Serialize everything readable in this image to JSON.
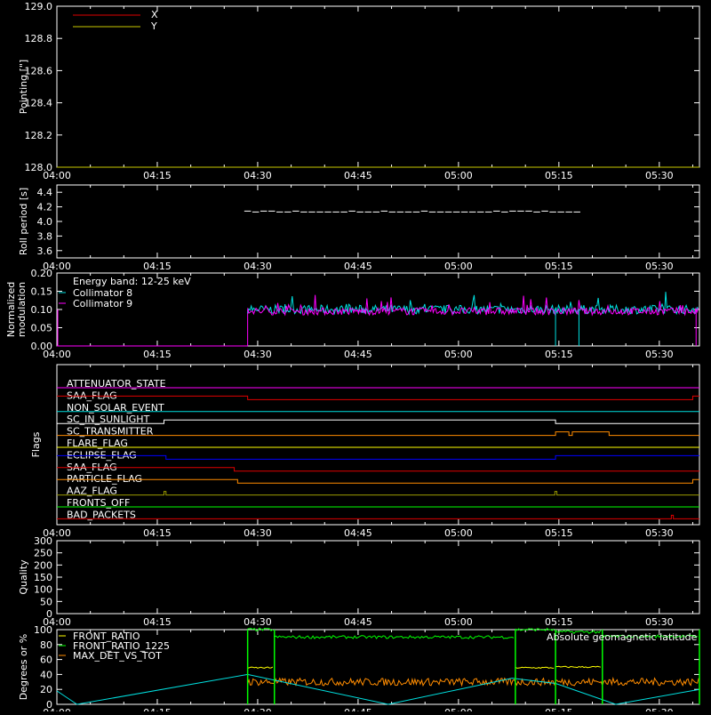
{
  "colors": {
    "bg": "#000000",
    "axis": "#ffffff",
    "red": "#e00000",
    "yellow": "#c8c800",
    "cyan": "#00e0e0",
    "magenta": "#ff00ff",
    "orange": "#ff8c00",
    "blue": "#0000ff",
    "green": "#00ff00",
    "olive": "#9a9a00",
    "white": "#ffffff"
  },
  "time_ticks": [
    "04:00",
    "04:15",
    "04:30",
    "04:45",
    "05:00",
    "05:15",
    "05:30"
  ],
  "chart_data": [
    {
      "type": "line",
      "ylabel": "Pointing [\"]",
      "ylim": [
        128.0,
        129.0
      ],
      "y_ticks": [
        "128.0",
        "128.2",
        "128.4",
        "128.6",
        "128.8",
        "129.0"
      ],
      "legend": [
        "X",
        "Y"
      ],
      "series": [
        {
          "name": "X",
          "color": "#e00000",
          "points": []
        },
        {
          "name": "Y",
          "color": "#c8c800",
          "points": [
            [
              0,
              128.0
            ],
            [
              96,
              128.0
            ]
          ]
        }
      ]
    },
    {
      "type": "line",
      "ylabel": "Roll period [s]",
      "ylim": [
        3.5,
        4.5
      ],
      "y_ticks": [
        "3.6",
        "3.8",
        "4.0",
        "4.2",
        "4.4"
      ],
      "series": [
        {
          "name": "roll",
          "color": "#ffffff",
          "points": [
            [
              28,
              4.13
            ],
            [
              78,
              4.13
            ]
          ]
        }
      ]
    },
    {
      "type": "line",
      "ylabel": "Normalized modulation",
      "ylim": [
        0.0,
        0.2
      ],
      "y_ticks": [
        "0.00",
        "0.05",
        "0.10",
        "0.15",
        "0.20"
      ],
      "annotations": [
        "Energy band: 12-25 keV"
      ],
      "legend": [
        "Collimator 8",
        "Collimator 9"
      ],
      "series": [
        {
          "name": "Collimator 8",
          "color": "#00e0e0",
          "level": 0.1,
          "noise": 0.012,
          "start": 28.5,
          "end": 96
        },
        {
          "name": "Collimator 9",
          "color": "#ff00ff",
          "level": 0.095,
          "noise": 0.01,
          "start": 28.5,
          "end": 96
        }
      ]
    },
    {
      "type": "table",
      "ylabel": "Flags",
      "flags": [
        {
          "name": "ATTENUATOR_STATE",
          "color": "#ff00ff",
          "steps": []
        },
        {
          "name": "SAA_FLAG",
          "color": "#e00000",
          "steps": [
            [
              0,
              1
            ],
            [
              28.5,
              0
            ],
            [
              95,
              1
            ]
          ]
        },
        {
          "name": "NON_SOLAR_EVENT",
          "color": "#00e0e0",
          "steps": []
        },
        {
          "name": "SC_IN_SUNLIGHT",
          "color": "#ffffff",
          "steps": [
            [
              0,
              0
            ],
            [
              16,
              1
            ],
            [
              74.5,
              0
            ]
          ]
        },
        {
          "name": "SC_TRANSMITTER",
          "color": "#ff8c00",
          "steps": [
            [
              0,
              0
            ],
            [
              74.5,
              1
            ],
            [
              76.5,
              0
            ],
            [
              77,
              1
            ],
            [
              82.5,
              0
            ]
          ]
        },
        {
          "name": "FLARE_FLAG",
          "color": "#ffff00",
          "steps": []
        },
        {
          "name": "ECLIPSE_FLAG",
          "color": "#0000ff",
          "steps": [
            [
              0,
              1
            ],
            [
              16.3,
              0
            ],
            [
              74.5,
              1
            ]
          ]
        },
        {
          "name": "SAA_FLAG",
          "color": "#e00000",
          "steps": [
            [
              0,
              1
            ],
            [
              26.5,
              0
            ]
          ]
        },
        {
          "name": "PARTICLE_FLAG",
          "color": "#ff8c00",
          "steps": [
            [
              0,
              1
            ],
            [
              27,
              0
            ],
            [
              95,
              1
            ]
          ]
        },
        {
          "name": "AAZ_FLAG",
          "color": "#9a9a00",
          "steps": [
            [
              0,
              0
            ],
            [
              16,
              1
            ],
            [
              16.3,
              0
            ],
            [
              74.4,
              1
            ],
            [
              74.7,
              0
            ]
          ]
        },
        {
          "name": "FRONTS_OFF",
          "color": "#00ff00",
          "steps": []
        },
        {
          "name": "BAD_PACKETS",
          "color": "#e00000",
          "steps": [
            [
              0,
              0
            ],
            [
              91.8,
              1
            ],
            [
              92.1,
              0
            ]
          ]
        }
      ]
    },
    {
      "type": "line",
      "ylabel": "Quality",
      "ylim": [
        0,
        300
      ],
      "y_ticks": [
        "0",
        "50",
        "100",
        "150",
        "200",
        "250",
        "300"
      ],
      "series": []
    },
    {
      "type": "line",
      "ylabel": "Degrees or %",
      "ylim": [
        0,
        100
      ],
      "y_ticks": [
        "0",
        "20",
        "40",
        "60",
        "80",
        "100"
      ],
      "legend": [
        "FRONT_RATIO",
        "FRONT_RATIO_1225",
        "MAX_DET_VS_TOT"
      ],
      "annotations": [
        "Absolute geomagnetic latitude"
      ],
      "series": [
        {
          "name": "FRONT_RATIO",
          "color": "#ffff00",
          "segments": [
            [
              28.5,
              32.5,
              49
            ],
            [
              68.5,
              74.5,
              49
            ],
            [
              74.5,
              81.5,
              50
            ]
          ]
        },
        {
          "name": "FRONT_RATIO_1225",
          "color": "#00ff00",
          "segments": [
            [
              28.5,
              32.5,
              100
            ],
            [
              32.5,
              68.5,
              90
            ],
            [
              68.5,
              74.5,
              100
            ],
            [
              74.5,
              81.5,
              97
            ],
            [
              81.5,
              96,
              91
            ]
          ]
        },
        {
          "name": "MAX_DET_VS_TOT",
          "color": "#ff8c00",
          "level": 30,
          "noise": 5,
          "start": 28.5,
          "end": 96
        },
        {
          "name": "Absolute geomagnetic latitude",
          "color": "#00e0e0",
          "points": [
            [
              0,
              18
            ],
            [
              3,
              0
            ],
            [
              28.5,
              40
            ],
            [
              49.5,
              0
            ],
            [
              68,
              35
            ],
            [
              74.5,
              28
            ],
            [
              83.5,
              0
            ],
            [
              96,
              20
            ]
          ]
        }
      ]
    }
  ]
}
